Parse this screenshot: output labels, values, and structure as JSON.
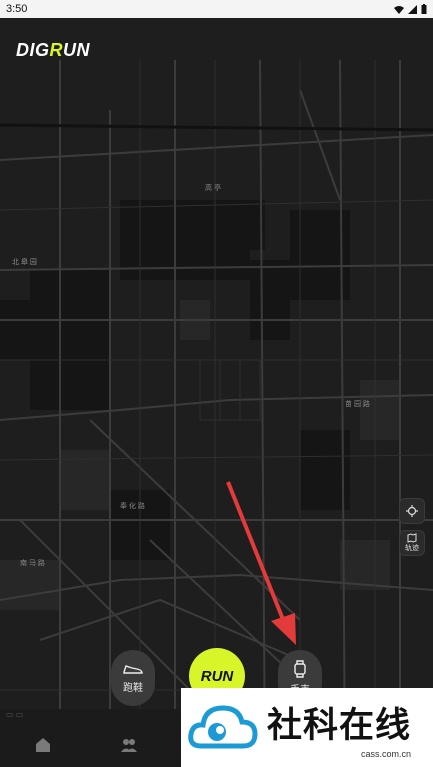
{
  "status_bar": {
    "time": "3:50"
  },
  "app": {
    "logo_text_start": "DIG",
    "logo_text_accent": "R",
    "logo_text_end": "UN"
  },
  "map": {
    "labels": [
      {
        "text": "北 皋 园"
      },
      {
        "text": "高 亭"
      },
      {
        "text": "苗 园 路"
      },
      {
        "text": "奉 化 路"
      },
      {
        "text": "南 马 路"
      }
    ]
  },
  "controls": {
    "locate_icon": "locate-icon",
    "track_label": "轨迹",
    "shoes_label": "跑鞋",
    "run_label": "RUN",
    "watch_label": "手表"
  },
  "bottom_nav": {
    "items": [
      "home-icon",
      "community-icon"
    ]
  },
  "watermark": {
    "title": "社科在线",
    "url": "cass.com.cn"
  },
  "colors": {
    "accent": "#d8f52a",
    "map_bg": "#1e1e1e",
    "arrow": "#e33a3a"
  }
}
